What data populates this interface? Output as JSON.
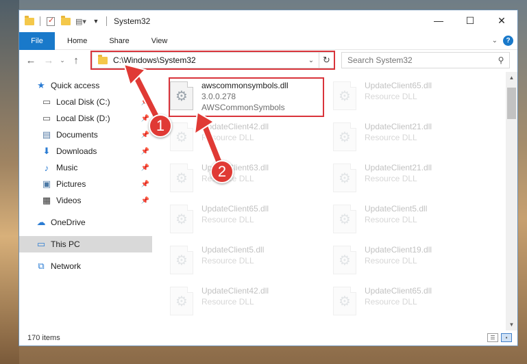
{
  "window": {
    "title": "System32",
    "controls": {
      "minimize": "—",
      "maximize": "☐",
      "close": "✕"
    }
  },
  "ribbon": {
    "tabs": [
      "File",
      "Home",
      "Share",
      "View"
    ],
    "help": "?"
  },
  "nav": {
    "address": "C:\\Windows\\System32",
    "search_placeholder": "Search System32"
  },
  "sidebar": {
    "quick_access": "Quick access",
    "items": [
      {
        "label": "Local Disk (C:)",
        "icon": "drive-icon",
        "pinned": true
      },
      {
        "label": "Local Disk (D:)",
        "icon": "drive-icon",
        "pinned": true
      },
      {
        "label": "Documents",
        "icon": "documents-icon",
        "pinned": true
      },
      {
        "label": "Downloads",
        "icon": "downloads-icon",
        "pinned": true
      },
      {
        "label": "Music",
        "icon": "music-icon",
        "pinned": true
      },
      {
        "label": "Pictures",
        "icon": "pictures-icon",
        "pinned": true
      },
      {
        "label": "Videos",
        "icon": "videos-icon",
        "pinned": true
      }
    ],
    "onedrive": "OneDrive",
    "this_pc": "This PC",
    "network": "Network"
  },
  "files": [
    {
      "name": "awscommonsymbols.dll",
      "line2": "3.0.0.278",
      "line3": "AWSCommonSymbols",
      "faded": false
    },
    {
      "name": "UpdateClient65.dll",
      "line2": "Resource DLL",
      "faded": true
    },
    {
      "name": "UpdateClient42.dll",
      "line2": "Resource DLL",
      "faded": true
    },
    {
      "name": "UpdateClient21.dll",
      "line2": "Resource DLL",
      "faded": true
    },
    {
      "name": "UpdateClient63.dll",
      "line2": "Resource DLL",
      "faded": true
    },
    {
      "name": "UpdateClient21.dll",
      "line2": "Resource DLL",
      "faded": true
    },
    {
      "name": "UpdateClient65.dll",
      "line2": "Resource DLL",
      "faded": true
    },
    {
      "name": "UpdateClient5.dll",
      "line2": "Resource DLL",
      "faded": true
    },
    {
      "name": "UpdateClient5.dll",
      "line2": "Resource DLL",
      "faded": true
    },
    {
      "name": "UpdateClient19.dll",
      "line2": "Resource DLL",
      "faded": true
    },
    {
      "name": "UpdateClient42.dll",
      "line2": "Resource DLL",
      "faded": true
    },
    {
      "name": "UpdateClient65.dll",
      "line2": "Resource DLL",
      "faded": true
    }
  ],
  "status": {
    "count": "170 items"
  },
  "callouts": [
    "1",
    "2"
  ],
  "colors": {
    "accent": "#1979ca",
    "highlight": "#d9333a",
    "callout": "#e03a35"
  }
}
